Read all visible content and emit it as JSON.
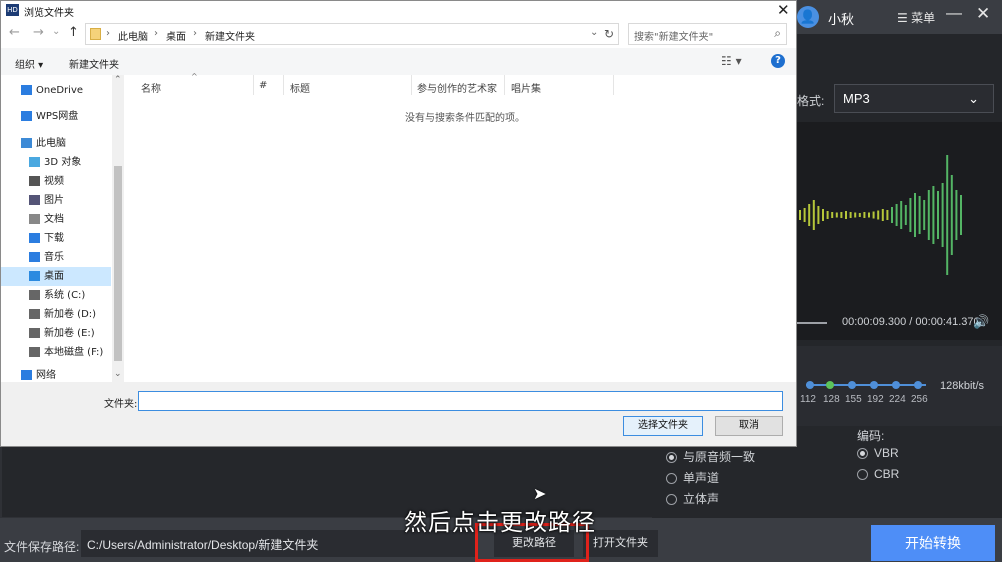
{
  "app": {
    "user_avatar": "👤",
    "user_name": "小秋",
    "menu_label": "☰ 菜单",
    "minimize": "—",
    "close": "✕",
    "format_label": "格式:",
    "format_value": "MP3",
    "time_text": "00:00:09.300 / 00:00:41.370",
    "bitrate_value": "128kbit/s",
    "bitrate_ticks": [
      "112",
      "128",
      "155",
      "192",
      "224",
      "256"
    ],
    "channel_options": [
      "与原音频一致",
      "单声道",
      "立体声"
    ],
    "encoding_label": "编码:",
    "encoding_options": [
      "VBR",
      "CBR"
    ],
    "path_label": "文件保存路径:",
    "path_value": "C:/Users/Administrator/Desktop/新建文件夹",
    "change_path": "更改路径",
    "open_folder": "打开文件夹",
    "start": "开始转换",
    "subtitle": "然后点击更改路径",
    "accent": "#4e8ef7",
    "highlight": "#e0221b"
  },
  "dialog": {
    "title": "浏览文件夹",
    "logo_text": "HD",
    "close": "✕",
    "nav": {
      "back": "←",
      "forward": "→",
      "down": "⌄",
      "up": "↑"
    },
    "breadcrumb": [
      "此电脑",
      "桌面",
      "新建文件夹"
    ],
    "refresh": "↻",
    "search_placeholder": "搜索\"新建文件夹\"",
    "search_icon": "⌕",
    "organize": "组织 ▾",
    "new_folder": "新建文件夹",
    "view_icon": "☷ ▾",
    "help": "?",
    "nav_items": [
      {
        "label": "OneDrive",
        "icon": "cloud-icon"
      },
      {
        "label": "WPS网盘",
        "icon": "cloud-icon"
      },
      {
        "label": "此电脑",
        "icon": "computer-icon"
      },
      {
        "label": "3D 对象",
        "icon": "cube-icon"
      },
      {
        "label": "视频",
        "icon": "video-icon"
      },
      {
        "label": "图片",
        "icon": "image-icon"
      },
      {
        "label": "文档",
        "icon": "document-icon"
      },
      {
        "label": "下载",
        "icon": "download-icon"
      },
      {
        "label": "音乐",
        "icon": "music-icon"
      },
      {
        "label": "桌面",
        "icon": "desktop-icon"
      },
      {
        "label": "系统 (C:)",
        "icon": "drive-icon"
      },
      {
        "label": "新加卷 (D:)",
        "icon": "drive-icon"
      },
      {
        "label": "新加卷 (E:)",
        "icon": "drive-icon"
      },
      {
        "label": "本地磁盘 (F:)",
        "icon": "drive-icon"
      },
      {
        "label": "网络",
        "icon": "network-icon"
      }
    ],
    "columns": [
      "名称",
      "#",
      "标题",
      "参与创作的艺术家",
      "唱片集"
    ],
    "empty_message": "没有与搜索条件匹配的项。",
    "folder_label": "文件夹:",
    "folder_value": "",
    "select_button": "选择文件夹",
    "cancel_button": "取消"
  }
}
